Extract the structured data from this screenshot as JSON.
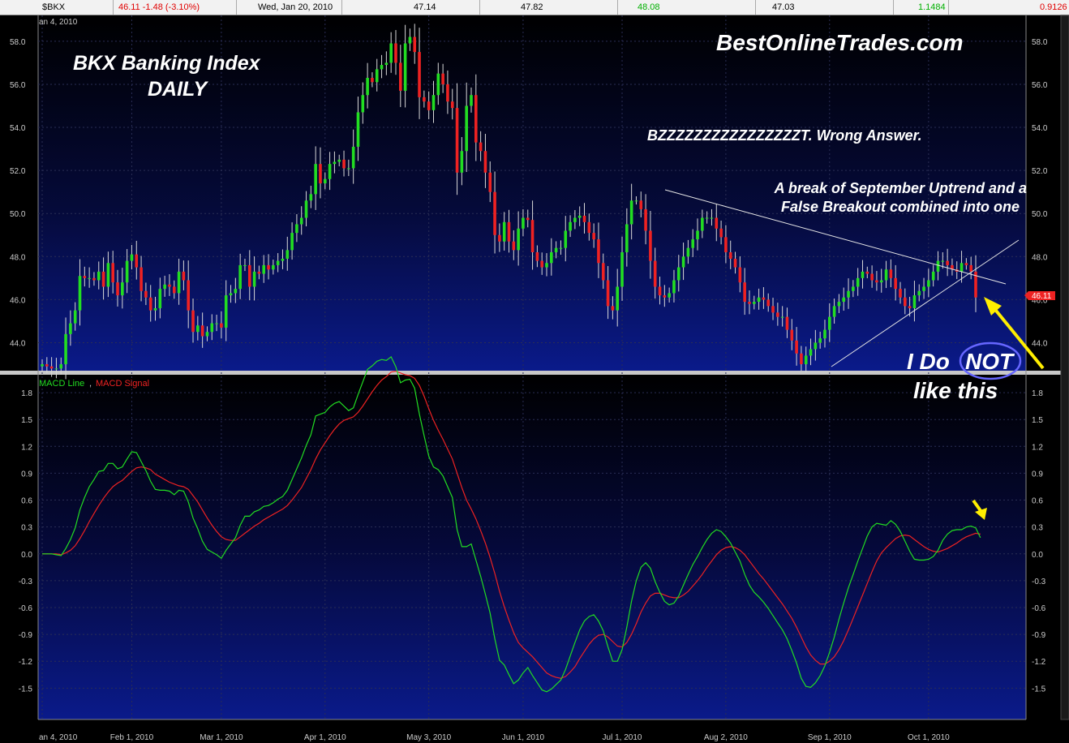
{
  "header": {
    "symbol": "$BKX",
    "quote": "46.11 -1.48 (-3.10%)",
    "date": "Wed, Jan 20, 2010",
    "open": "47.14",
    "high": "47.82",
    "close": "48.08",
    "low": "47.03",
    "macd_value": "1.1484",
    "signal_value": "0.9126"
  },
  "colors": {
    "up_candle": "#22dd22",
    "down_candle": "#ee2222",
    "macd_line": "#22dd22",
    "signal_line": "#ee2222",
    "annotation_arrow": "#ffee00",
    "not_circle": "#6666ff",
    "price_tag": "#ee2222"
  },
  "annotations": {
    "site": "BestOnlineTrades.com",
    "title_line1": "BKX Banking Index",
    "title_line2": "DAILY",
    "buzz": "BZZZZZZZZZZZZZZZZT.  Wrong Answer.",
    "break_line1": "A break of September Uptrend and a",
    "break_line2": "False Breakout combined into one",
    "i_do": "I Do",
    "not": "NOT",
    "like_this": "like this",
    "price_tag": "46.11",
    "start_date": "an 4, 2010"
  },
  "chart_data": [
    {
      "type": "candlestick",
      "ylim": [
        42.7,
        59.2
      ],
      "yticks": [
        "44.0",
        "46.0",
        "48.0",
        "50.0",
        "52.0",
        "54.0",
        "56.0",
        "58.0"
      ],
      "ytick_values": [
        44,
        46,
        48,
        50,
        52,
        54,
        56,
        58
      ],
      "xtick_labels": [
        "an 4, 2010",
        "Feb 1, 2010",
        "Mar 1, 2010",
        "Apr 1, 2010",
        "May 3, 2010",
        "Jun 1, 2010",
        "Jul 1, 2010",
        "Aug 2, 2010",
        "Sep 1, 2010",
        "Oct 1, 2010"
      ],
      "xtick_index": [
        0,
        19,
        38,
        60,
        82,
        102,
        123,
        145,
        167,
        188
      ],
      "grid": true,
      "closes": [
        43.0,
        42.9,
        42.8,
        42.8,
        43.0,
        44.4,
        44.9,
        45.5,
        47.1,
        47.0,
        47.0,
        46.9,
        47.3,
        46.6,
        47.7,
        46.8,
        46.2,
        46.8,
        47.8,
        48.1,
        47.5,
        46.4,
        46.1,
        45.5,
        45.6,
        46.5,
        46.7,
        46.6,
        46.3,
        47.3,
        46.9,
        45.5,
        44.5,
        44.8,
        44.3,
        44.5,
        44.9,
        44.9,
        44.7,
        46.2,
        46.3,
        46.5,
        47.6,
        47.6,
        46.6,
        47.3,
        47.2,
        47.6,
        47.4,
        47.6,
        47.8,
        47.9,
        48.3,
        49.1,
        49.5,
        49.8,
        50.6,
        50.9,
        52.3,
        51.4,
        51.6,
        52.3,
        52.4,
        52.5,
        52.1,
        52.1,
        53.1,
        54.7,
        55.5,
        56.3,
        56.1,
        56.7,
        56.9,
        57.0,
        57.9,
        57.0,
        55.7,
        57.9,
        58.2,
        57.5,
        55.4,
        55.2,
        54.8,
        55.5,
        56.5,
        56.0,
        55.2,
        54.9,
        51.9,
        52.9,
        55.0,
        55.5,
        53.3,
        52.9,
        51.9,
        51.0,
        49.0,
        48.7,
        49.6,
        48.7,
        48.3,
        49.3,
        49.8,
        49.7,
        48.2,
        47.8,
        47.5,
        47.7,
        48.2,
        48.4,
        48.4,
        49.2,
        49.6,
        49.8,
        49.9,
        49.6,
        49.1,
        48.8,
        47.7,
        46.9,
        45.7,
        45.5,
        46.6,
        48.2,
        49.5,
        50.6,
        50.6,
        50.2,
        49.2,
        47.8,
        46.6,
        46.2,
        46.1,
        46.3,
        46.9,
        47.5,
        48.0,
        48.4,
        48.8,
        49.2,
        49.8,
        49.8,
        49.8,
        49.3,
        48.9,
        48.2,
        47.9,
        47.5,
        46.8,
        45.9,
        45.8,
        45.9,
        46.1,
        46.0,
        45.7,
        45.4,
        45.2,
        45.2,
        44.6,
        44.1,
        43.5,
        43.0,
        43.4,
        43.7,
        44.0,
        44.2,
        44.6,
        45.2,
        45.7,
        45.9,
        46.1,
        46.4,
        46.6,
        47.0,
        47.3,
        47.2,
        46.9,
        46.8,
        46.9,
        47.4,
        47.0,
        46.5,
        46.1,
        45.7,
        45.6,
        46.2,
        46.4,
        46.6,
        46.9,
        47.3,
        47.8,
        47.8,
        47.6,
        47.4,
        47.3,
        47.7,
        47.6,
        47.3,
        46.1
      ]
    },
    {
      "type": "line",
      "ylim": [
        -1.85,
        2.0
      ],
      "yticks": [
        "-1.5",
        "-1.2",
        "-0.9",
        "-0.6",
        "-0.3",
        "0.0",
        "0.3",
        "0.6",
        "0.9",
        "1.2",
        "1.5",
        "1.8"
      ],
      "ytick_values": [
        -1.5,
        -1.2,
        -0.9,
        -0.6,
        -0.3,
        0.0,
        0.3,
        0.6,
        0.9,
        1.2,
        1.5,
        1.8
      ],
      "grid": true,
      "series": [
        {
          "name": "MACD Line",
          "values": [
            0.0,
            0.0,
            0.0,
            -0.01,
            -0.02,
            0.06,
            0.16,
            0.29,
            0.49,
            0.63,
            0.75,
            0.83,
            0.92,
            0.93,
            1.01,
            1.01,
            0.95,
            0.97,
            1.06,
            1.14,
            1.13,
            1.03,
            0.93,
            0.81,
            0.72,
            0.71,
            0.71,
            0.7,
            0.66,
            0.71,
            0.7,
            0.58,
            0.4,
            0.28,
            0.14,
            0.05,
            0.02,
            -0.01,
            -0.05,
            0.04,
            0.11,
            0.18,
            0.32,
            0.42,
            0.42,
            0.47,
            0.49,
            0.53,
            0.54,
            0.57,
            0.61,
            0.64,
            0.71,
            0.83,
            0.95,
            1.07,
            1.21,
            1.33,
            1.54,
            1.56,
            1.58,
            1.64,
            1.68,
            1.7,
            1.65,
            1.6,
            1.63,
            1.78,
            1.92,
            2.06,
            2.1,
            2.15,
            2.17,
            2.16,
            2.2,
            2.09,
            1.91,
            1.94,
            1.95,
            1.85,
            1.56,
            1.32,
            1.09,
            0.97,
            0.94,
            0.87,
            0.75,
            0.63,
            0.27,
            0.08,
            0.08,
            0.11,
            -0.07,
            -0.25,
            -0.45,
            -0.66,
            -0.95,
            -1.19,
            -1.24,
            -1.35,
            -1.45,
            -1.41,
            -1.33,
            -1.27,
            -1.36,
            -1.44,
            -1.52,
            -1.54,
            -1.51,
            -1.46,
            -1.41,
            -1.29,
            -1.14,
            -0.99,
            -0.85,
            -0.75,
            -0.7,
            -0.68,
            -0.75,
            -0.86,
            -1.04,
            -1.2,
            -1.2,
            -1.07,
            -0.82,
            -0.53,
            -0.3,
            -0.15,
            -0.1,
            -0.16,
            -0.31,
            -0.43,
            -0.53,
            -0.57,
            -0.55,
            -0.47,
            -0.35,
            -0.23,
            -0.12,
            -0.03,
            0.07,
            0.16,
            0.23,
            0.27,
            0.25,
            0.19,
            0.12,
            0.02,
            -0.08,
            -0.23,
            -0.35,
            -0.43,
            -0.48,
            -0.54,
            -0.61,
            -0.69,
            -0.77,
            -0.85,
            -0.95,
            -1.08,
            -1.22,
            -1.39,
            -1.48,
            -1.49,
            -1.44,
            -1.36,
            -1.25,
            -1.1,
            -0.93,
            -0.73,
            -0.55,
            -0.38,
            -0.23,
            -0.08,
            0.06,
            0.2,
            0.3,
            0.34,
            0.33,
            0.32,
            0.37,
            0.33,
            0.25,
            0.14,
            0.03,
            -0.06,
            -0.07,
            -0.07,
            -0.06,
            -0.03,
            0.04,
            0.15,
            0.22,
            0.26,
            0.27,
            0.27,
            0.3,
            0.31,
            0.29,
            0.18
          ]
        },
        {
          "name": "MACD Signal",
          "values": [
            0.0,
            0.0,
            0.0,
            -0.0,
            -0.01,
            0.01,
            0.04,
            0.09,
            0.17,
            0.26,
            0.36,
            0.45,
            0.54,
            0.62,
            0.69,
            0.75,
            0.79,
            0.82,
            0.87,
            0.92,
            0.96,
            0.97,
            0.96,
            0.94,
            0.89,
            0.86,
            0.83,
            0.8,
            0.78,
            0.76,
            0.75,
            0.72,
            0.65,
            0.58,
            0.49,
            0.4,
            0.32,
            0.25,
            0.19,
            0.16,
            0.15,
            0.15,
            0.19,
            0.23,
            0.27,
            0.31,
            0.34,
            0.38,
            0.41,
            0.44,
            0.47,
            0.5,
            0.54,
            0.6,
            0.67,
            0.74,
            0.84,
            0.94,
            1.06,
            1.16,
            1.24,
            1.32,
            1.39,
            1.45,
            1.49,
            1.51,
            1.53,
            1.58,
            1.65,
            1.73,
            1.81,
            1.88,
            1.94,
            1.98,
            2.03,
            2.04,
            2.02,
            2.0,
            1.99,
            1.96,
            1.88,
            1.76,
            1.62,
            1.49,
            1.38,
            1.28,
            1.17,
            1.06,
            0.9,
            0.74,
            0.6,
            0.5,
            0.39,
            0.26,
            0.12,
            -0.04,
            -0.22,
            -0.42,
            -0.59,
            -0.74,
            -0.88,
            -0.99,
            -1.05,
            -1.1,
            -1.15,
            -1.21,
            -1.27,
            -1.33,
            -1.36,
            -1.38,
            -1.39,
            -1.37,
            -1.32,
            -1.26,
            -1.17,
            -1.09,
            -1.01,
            -0.95,
            -0.91,
            -0.9,
            -0.93,
            -0.98,
            -1.03,
            -1.04,
            -0.99,
            -0.9,
            -0.78,
            -0.65,
            -0.55,
            -0.47,
            -0.44,
            -0.44,
            -0.46,
            -0.48,
            -0.49,
            -0.49,
            -0.46,
            -0.42,
            -0.36,
            -0.3,
            -0.23,
            -0.15,
            -0.08,
            -0.01,
            0.04,
            0.07,
            0.08,
            0.07,
            0.04,
            -0.01,
            -0.08,
            -0.15,
            -0.22,
            -0.28,
            -0.35,
            -0.42,
            -0.49,
            -0.56,
            -0.64,
            -0.72,
            -0.82,
            -0.93,
            -1.04,
            -1.13,
            -1.19,
            -1.23,
            -1.23,
            -1.2,
            -1.15,
            -1.07,
            -0.97,
            -0.85,
            -0.72,
            -0.59,
            -0.46,
            -0.33,
            -0.2,
            -0.08,
            0.01,
            0.07,
            0.12,
            0.17,
            0.2,
            0.21,
            0.2,
            0.16,
            0.12,
            0.08,
            0.05,
            0.03,
            0.02,
            0.04,
            0.06,
            0.09,
            0.12,
            0.16,
            0.19,
            0.21,
            0.23,
            0.22
          ]
        }
      ],
      "legend": "top-left"
    }
  ]
}
